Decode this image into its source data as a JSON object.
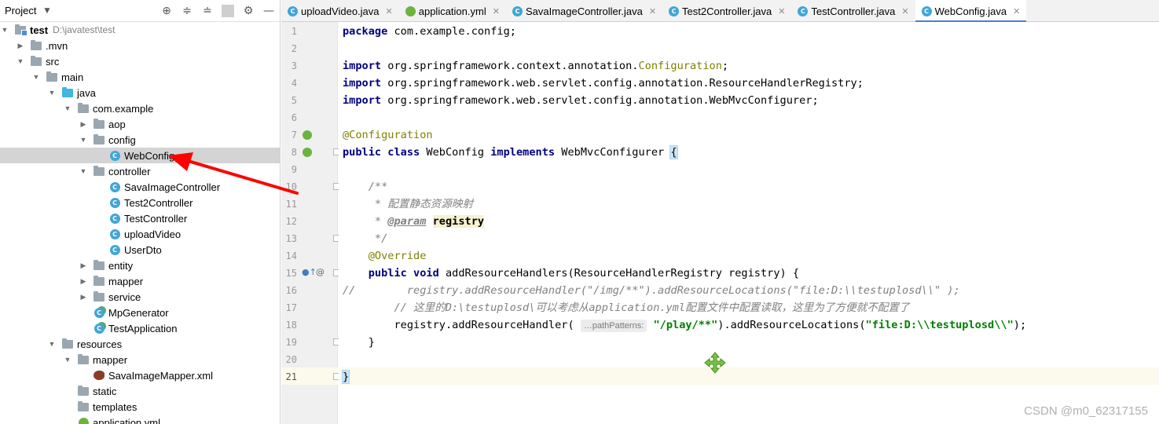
{
  "project_panel": {
    "title": "Project",
    "tools": [
      "target-icon",
      "expand-all-icon",
      "collapse-all-icon",
      "gear-icon",
      "minimize-icon"
    ],
    "tree": [
      {
        "label": "test",
        "path": "D:\\javatest\\test",
        "type": "module",
        "level": 0,
        "expanded": true
      },
      {
        "label": ".mvn",
        "type": "folder",
        "level": 1,
        "expanded": false
      },
      {
        "label": "src",
        "type": "folder",
        "level": 1,
        "expanded": true
      },
      {
        "label": "main",
        "type": "folder",
        "level": 2,
        "expanded": true
      },
      {
        "label": "java",
        "type": "folder-blue",
        "level": 3,
        "expanded": true
      },
      {
        "label": "com.example",
        "type": "folder",
        "level": 4,
        "expanded": true
      },
      {
        "label": "aop",
        "type": "folder",
        "level": 5,
        "expanded": false
      },
      {
        "label": "config",
        "type": "folder",
        "level": 5,
        "expanded": true
      },
      {
        "label": "WebConfig",
        "type": "class",
        "level": 6,
        "selected": true
      },
      {
        "label": "controller",
        "type": "folder",
        "level": 5,
        "expanded": true
      },
      {
        "label": "SavaImageController",
        "type": "class",
        "level": 6
      },
      {
        "label": "Test2Controller",
        "type": "class",
        "level": 6
      },
      {
        "label": "TestController",
        "type": "class",
        "level": 6
      },
      {
        "label": "uploadVideo",
        "type": "class",
        "level": 6
      },
      {
        "label": "UserDto",
        "type": "class",
        "level": 6
      },
      {
        "label": "entity",
        "type": "folder",
        "level": 5,
        "expanded": false
      },
      {
        "label": "mapper",
        "type": "folder",
        "level": 5,
        "expanded": false
      },
      {
        "label": "service",
        "type": "folder",
        "level": 5,
        "expanded": false
      },
      {
        "label": "MpGenerator",
        "type": "class-run",
        "level": 5
      },
      {
        "label": "TestApplication",
        "type": "class-run",
        "level": 5
      },
      {
        "label": "resources",
        "type": "folder",
        "level": 3,
        "expanded": true
      },
      {
        "label": "mapper",
        "type": "folder",
        "level": 4,
        "expanded": true
      },
      {
        "label": "SavaImageMapper.xml",
        "type": "xml",
        "level": 5
      },
      {
        "label": "static",
        "type": "folder",
        "level": 4
      },
      {
        "label": "templates",
        "type": "folder",
        "level": 4
      },
      {
        "label": "application.yml",
        "type": "yml",
        "level": 4
      }
    ]
  },
  "tabs": [
    {
      "label": "uploadVideo.java",
      "icon": "class",
      "active": false
    },
    {
      "label": "application.yml",
      "icon": "yml",
      "active": false
    },
    {
      "label": "SavaImageController.java",
      "icon": "class",
      "active": false
    },
    {
      "label": "Test2Controller.java",
      "icon": "class",
      "active": false
    },
    {
      "label": "TestController.java",
      "icon": "class",
      "active": false
    },
    {
      "label": "WebConfig.java",
      "icon": "class",
      "active": true
    }
  ],
  "editor": {
    "current_line": 21,
    "line_numbers": [
      "1",
      "2",
      "3",
      "4",
      "5",
      "6",
      "7",
      "8",
      "9",
      "10",
      "11",
      "12",
      "13",
      "14",
      "15",
      "16",
      "17",
      "18",
      "19",
      "20",
      "21"
    ],
    "lines": [
      [
        {
          "t": "package",
          "c": "kw"
        },
        {
          "t": " com.example.config;"
        }
      ],
      [],
      [
        {
          "t": "import",
          "c": "kw"
        },
        {
          "t": " org.springframework.context.annotation."
        },
        {
          "t": "Configuration",
          "c": "ann"
        },
        {
          "t": ";"
        }
      ],
      [
        {
          "t": "import",
          "c": "kw"
        },
        {
          "t": " org.springframework.web.servlet.config.annotation.ResourceHandlerRegistry;"
        }
      ],
      [
        {
          "t": "import",
          "c": "kw"
        },
        {
          "t": " org.springframework.web.servlet.config.annotation.WebMvcConfigurer;"
        }
      ],
      [],
      [
        {
          "t": "@Configuration",
          "c": "ann"
        }
      ],
      [
        {
          "t": "public class",
          "c": "kw"
        },
        {
          "t": " WebConfig "
        },
        {
          "t": "implements",
          "c": "kw"
        },
        {
          "t": " WebMvcConfigurer "
        },
        {
          "t": "{",
          "c": "brace-hl"
        }
      ],
      [],
      [
        {
          "t": "    /**",
          "c": "cmt"
        }
      ],
      [
        {
          "t": "     * 配置静态资源映射",
          "c": "cmt"
        }
      ],
      [
        {
          "t": "     * ",
          "c": "cmt"
        },
        {
          "t": "@param",
          "c": "doc-tag"
        },
        {
          "t": " ",
          "c": "cmt"
        },
        {
          "t": "registry",
          "c": "hl-param"
        }
      ],
      [
        {
          "t": "     */",
          "c": "cmt"
        }
      ],
      [
        {
          "t": "    @Override",
          "c": "ann"
        }
      ],
      [
        {
          "t": "    "
        },
        {
          "t": "public void",
          "c": "kw"
        },
        {
          "t": " addResourceHandlers(ResourceHandlerRegistry registry) {"
        }
      ],
      [
        {
          "t": "//        registry.addResourceHandler(\"/img/**\").addResourceLocations(\"file:D:\\\\testuplosd\\\\\" );",
          "c": "cmt"
        }
      ],
      [
        {
          "t": "        // 这里的D:\\testuplosd\\可以考虑从application.yml配置文件中配置读取，这里为了方便就不配置了",
          "c": "cmt"
        }
      ],
      [
        {
          "t": "        registry.addResourceHandler( "
        },
        {
          "t": "…pathPatterns:",
          "c": "hint"
        },
        {
          "t": " "
        },
        {
          "t": "\"/play/**\"",
          "c": "str"
        },
        {
          "t": ").addResourceLocations("
        },
        {
          "t": "\"file:D:\\\\testuplosd\\\\\"",
          "c": "str"
        },
        {
          "t": ");"
        }
      ],
      [
        {
          "t": "    }"
        }
      ],
      [],
      [
        {
          "t": "}",
          "c": "brace-hl"
        }
      ]
    ]
  },
  "watermark": "CSDN @m0_62317155",
  "colors": {
    "accent": "#4083c9",
    "annotation": "#808000",
    "keyword": "#000080",
    "string": "#008000",
    "arrow": "#ff0000"
  }
}
